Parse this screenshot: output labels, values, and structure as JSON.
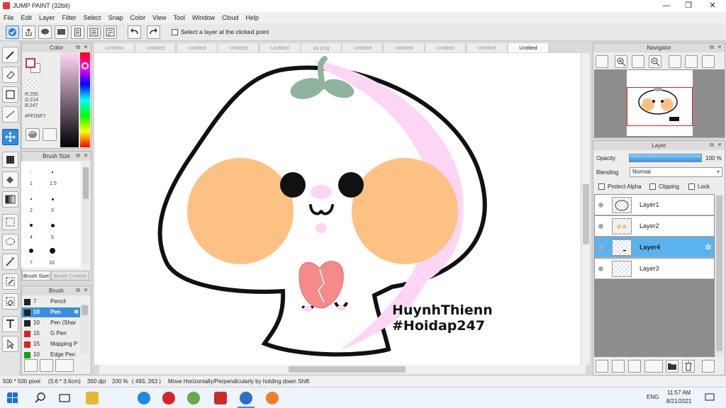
{
  "window": {
    "title": "JUMP PAINT (32bit)",
    "min": "—",
    "max": "❐",
    "close": "✕"
  },
  "menu": [
    "File",
    "Edit",
    "Layer",
    "Filter",
    "Select",
    "Snap",
    "Color",
    "View",
    "Tool",
    "Window",
    "Cloud",
    "Help"
  ],
  "toolbar": {
    "select_layer_label": "Select a layer at the clicked point",
    "select_layer_checked": false
  },
  "color_panel": {
    "title": "Color",
    "r": "R:255",
    "g": "G:214",
    "b": "B:247",
    "hex": "#FFD6F7",
    "current": "#ffd6f7"
  },
  "brush_size_panel": {
    "title": "Brush Size",
    "sizes": [
      "1",
      "1.5",
      "2",
      "3",
      "4",
      "5",
      "7",
      "10"
    ],
    "tab_active": "Brush Size",
    "tab_other": "Brush Control"
  },
  "brush_panel": {
    "title": "Brush",
    "items": [
      {
        "color": "#222222",
        "size": "7",
        "name": "Pencil",
        "selected": false,
        "size_color": "#d00000"
      },
      {
        "color": "#222222",
        "size": "10",
        "name": "Pen",
        "selected": true,
        "size_color": "#ffffff"
      },
      {
        "color": "#222222",
        "size": "10",
        "name": "Pen (Shar",
        "selected": false,
        "size_color": "#222222"
      },
      {
        "color": "#e02020",
        "size": "15",
        "name": "G Pen",
        "selected": false,
        "size_color": "#222222"
      },
      {
        "color": "#e02020",
        "size": "15",
        "name": "Mapping P",
        "selected": false,
        "size_color": "#222222"
      },
      {
        "color": "#10a010",
        "size": "10",
        "name": "Edge Pen",
        "selected": false,
        "size_color": "#222222"
      }
    ]
  },
  "doc_tabs": [
    "Untitled",
    "Untitled",
    "Untitled",
    "Untitled",
    "Untitled",
    "ya.png",
    "Untitled",
    "Untitled",
    "Untitled",
    "Untitled",
    "Untitled"
  ],
  "active_tab_index": 10,
  "watermark": {
    "line1": "HuynhThienn",
    "line2": "#Hoidap247"
  },
  "navigator": {
    "title": "Navigator"
  },
  "layer_panel": {
    "title": "Layer",
    "opacity_label": "Opacity",
    "opacity_value": "100 %",
    "opacity": 1.0,
    "blending_label": "Blending",
    "blending_value": "Normal",
    "protect_alpha": "Protect Alpha",
    "clipping": "Clipping",
    "lock": "Lock",
    "layers": [
      {
        "name": "Layer1",
        "selected": false
      },
      {
        "name": "Layer2",
        "selected": false
      },
      {
        "name": "Layer4",
        "selected": true
      },
      {
        "name": "Layer3",
        "selected": false
      }
    ]
  },
  "status": {
    "size": "500 * 500 pixel",
    "cm": "(3.6 * 3.6cm)",
    "dpi": "350 dpi",
    "zoom": "200 %",
    "coords": "( 493, 263 )",
    "hint": "Move Horizontally/Perpendicularly by holding down Shift"
  },
  "taskbar": {
    "time": "11:57 AM",
    "date": "8/21/2021",
    "lang": "ENG"
  },
  "colors": {
    "cheek": "#fdc184",
    "pink": "#fcd6f4",
    "leaf": "#8fb39c",
    "heart": "#f48a8a",
    "accent": "#3b8fe0"
  }
}
